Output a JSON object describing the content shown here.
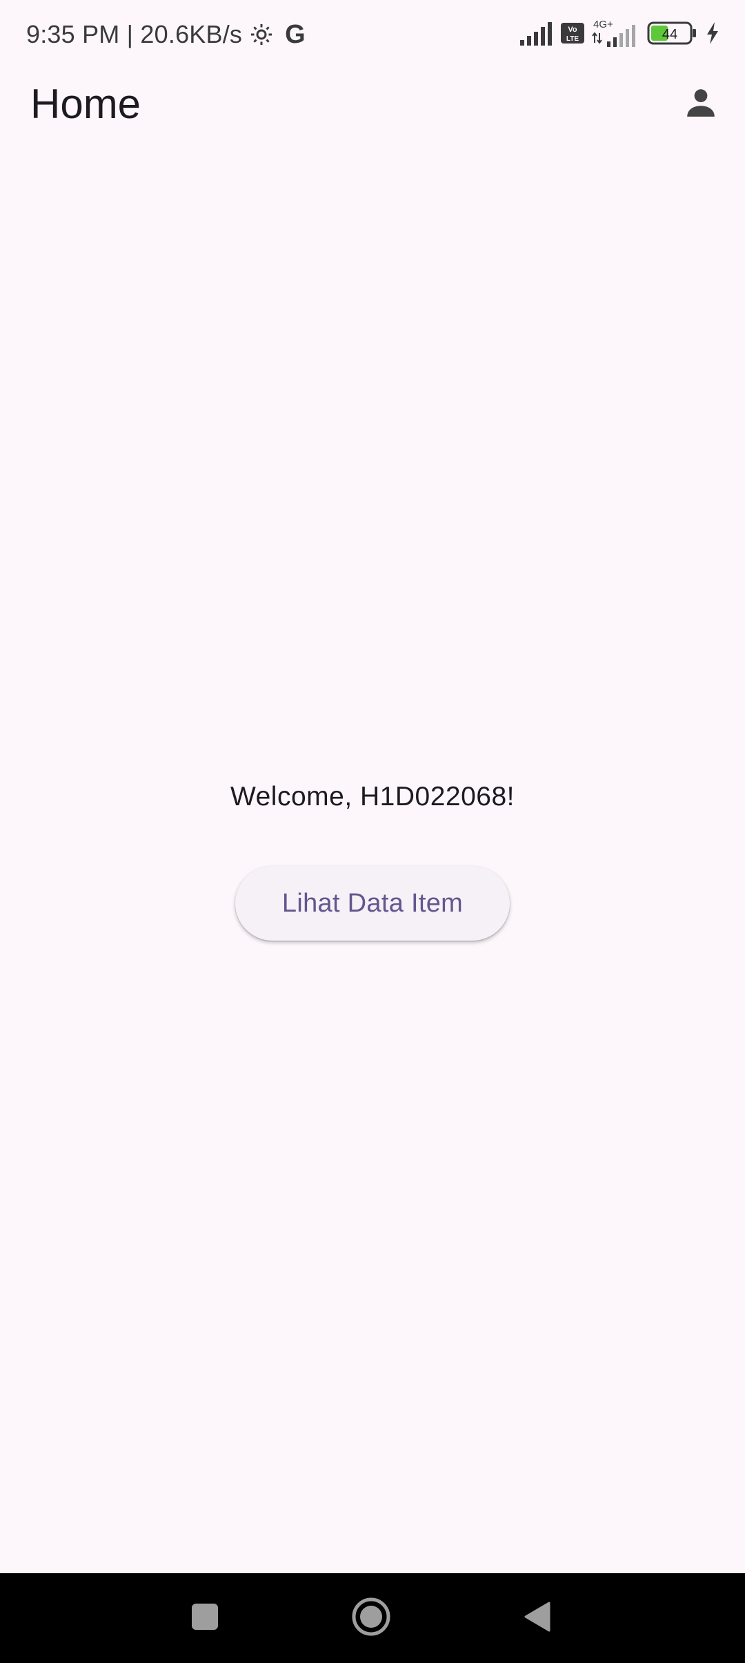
{
  "status_bar": {
    "time_speed": "9:35 PM | 20.6KB/s",
    "g_label": "G",
    "volte_top": "Vo",
    "volte_bottom": "LTE",
    "network_type": "4G+",
    "battery_level": "44",
    "icons": [
      "settings-gear-icon",
      "google-g-icon",
      "signal-icon",
      "volte-icon",
      "signal-4g-icon",
      "battery-icon",
      "charging-bolt-icon"
    ]
  },
  "app_bar": {
    "title": "Home",
    "profile_icon": "person-icon"
  },
  "main": {
    "welcome_text": "Welcome, H1D022068!",
    "button_label": "Lihat Data Item"
  },
  "nav_bar": {
    "icons": [
      "recents-square-icon",
      "home-circle-icon",
      "back-triangle-icon"
    ]
  },
  "colors": {
    "background": "#FDF7FC",
    "button_text": "#65558F",
    "button_bg": "#F5F1F6",
    "battery_fill": "#5DC83A"
  }
}
